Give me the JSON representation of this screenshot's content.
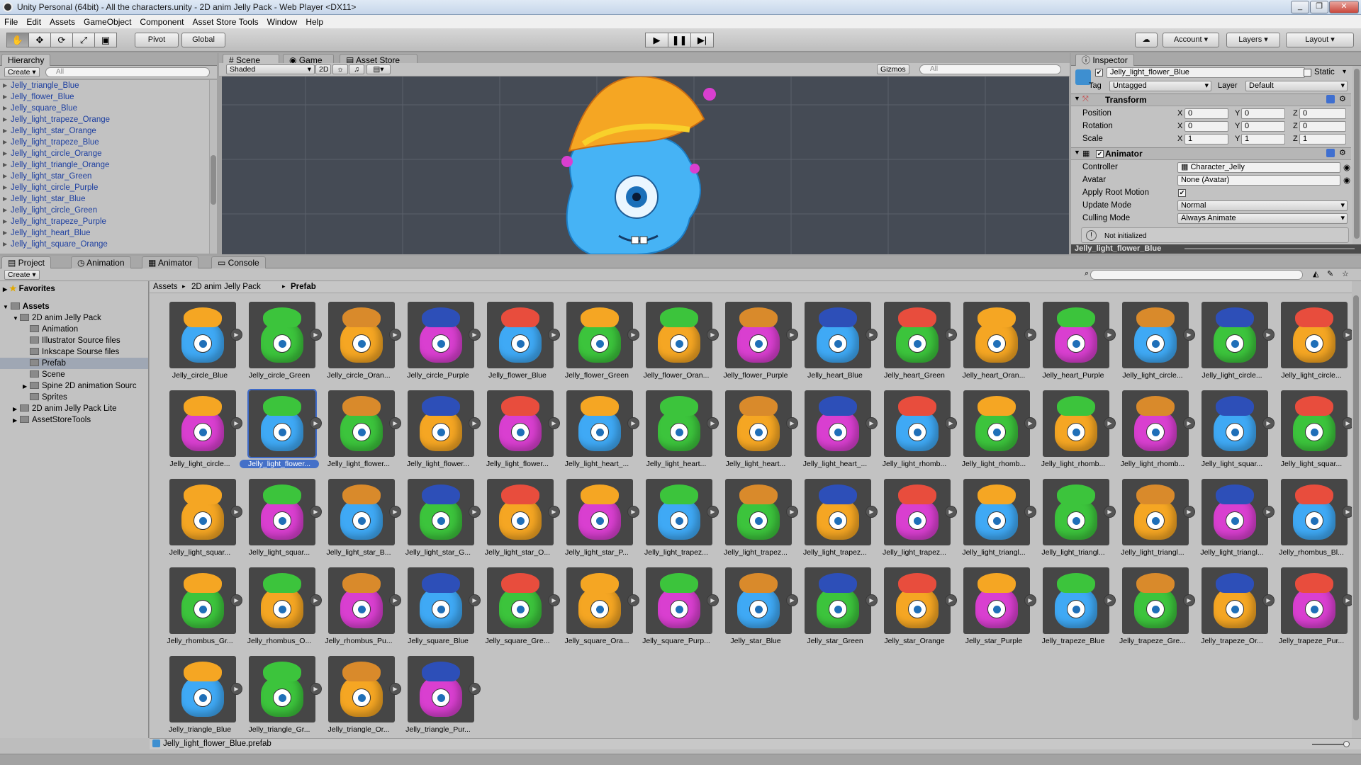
{
  "window": {
    "title": "Unity Personal (64bit) - All the characters.unity - 2D anim Jelly Pack - Web Player <DX11>"
  },
  "menu": [
    "File",
    "Edit",
    "Assets",
    "GameObject",
    "Component",
    "Asset Store Tools",
    "Window",
    "Help"
  ],
  "toolbar": {
    "pivot": "Pivot",
    "global": "Global",
    "account": "Account",
    "layers": "Layers",
    "layout": "Layout"
  },
  "hierarchy": {
    "tab": "Hierarchy",
    "create": "Create",
    "search_placeholder": "All",
    "items": [
      "Jelly_triangle_Blue",
      "Jelly_flower_Blue",
      "Jelly_square_Blue",
      "Jelly_light_trapeze_Orange",
      "Jelly_light_star_Orange",
      "Jelly_light_trapeze_Blue",
      "Jelly_light_circle_Orange",
      "Jelly_light_triangle_Orange",
      "Jelly_light_star_Green",
      "Jelly_light_circle_Purple",
      "Jelly_light_star_Blue",
      "Jelly_light_circle_Green",
      "Jelly_light_trapeze_Purple",
      "Jelly_light_heart_Blue",
      "Jelly_light_square_Orange"
    ]
  },
  "scene": {
    "tabs": [
      "Scene",
      "Game",
      "Asset Store"
    ],
    "shading": "Shaded",
    "mode2d": "2D",
    "gizmos": "Gizmos",
    "search_placeholder": "All"
  },
  "inspector": {
    "tab": "Inspector",
    "object_name": "Jelly_light_flower_Blue",
    "static": "Static",
    "tag_label": "Tag",
    "tag": "Untagged",
    "layer_label": "Layer",
    "layer": "Default",
    "transform": {
      "title": "Transform",
      "position_label": "Position",
      "rotation_label": "Rotation",
      "scale_label": "Scale",
      "position": [
        "0",
        "0",
        "0"
      ],
      "rotation": [
        "0",
        "0",
        "0"
      ],
      "scale": [
        "1",
        "1",
        "1"
      ]
    },
    "animator": {
      "title": "Animator",
      "controller_label": "Controller",
      "controller": "Character_Jelly",
      "avatar_label": "Avatar",
      "avatar": "None (Avatar)",
      "root_motion_label": "Apply Root Motion",
      "update_label": "Update Mode",
      "update": "Normal",
      "culling_label": "Culling Mode",
      "culling": "Always Animate",
      "status": "Not initialized"
    },
    "preview_name": "Jelly_light_flower_Blue"
  },
  "bottom_tabs": [
    "Project",
    "Animation",
    "Animator",
    "Console"
  ],
  "project": {
    "create": "Create",
    "favorites": "Favorites",
    "assets": "Assets",
    "tree": [
      "2D anim Jelly Pack",
      "Animation",
      "Illustrator Source files",
      "Inkscape Sourse files",
      "Prefab",
      "Scene",
      "Spine 2D animation Sourc",
      "Sprites",
      "2D anim Jelly Pack Lite",
      "AssetStoreTools"
    ],
    "breadcrumb": [
      "Assets",
      "2D anim Jelly Pack",
      "Prefab"
    ],
    "items": [
      "Jelly_circle_Blue",
      "Jelly_circle_Green",
      "Jelly_circle_Oran...",
      "Jelly_circle_Purple",
      "Jelly_flower_Blue",
      "Jelly_flower_Green",
      "Jelly_flower_Oran...",
      "Jelly_flower_Purple",
      "Jelly_heart_Blue",
      "Jelly_heart_Green",
      "Jelly_heart_Oran...",
      "Jelly_heart_Purple",
      "Jelly_light_circle...",
      "Jelly_light_circle...",
      "Jelly_light_circle...",
      "Jelly_light_circle...",
      "Jelly_light_flower...",
      "Jelly_light_flower...",
      "Jelly_light_flower...",
      "Jelly_light_flower...",
      "Jelly_light_heart_...",
      "Jelly_light_heart...",
      "Jelly_light_heart...",
      "Jelly_light_heart_...",
      "Jelly_light_rhomb...",
      "Jelly_light_rhomb...",
      "Jelly_light_rhomb...",
      "Jelly_light_rhomb...",
      "Jelly_light_squar...",
      "Jelly_light_squar...",
      "Jelly_light_squar...",
      "Jelly_light_squar...",
      "Jelly_light_star_B...",
      "Jelly_light_star_G...",
      "Jelly_light_star_O...",
      "Jelly_light_star_P...",
      "Jelly_light_trapez...",
      "Jelly_light_trapez...",
      "Jelly_light_trapez...",
      "Jelly_light_trapez...",
      "Jelly_light_triangl...",
      "Jelly_light_triangl...",
      "Jelly_light_triangl...",
      "Jelly_light_triangl...",
      "Jelly_rhombus_Bl...",
      "Jelly_rhombus_Gr...",
      "Jelly_rhombus_O...",
      "Jelly_rhombus_Pu...",
      "Jelly_square_Blue",
      "Jelly_square_Gre...",
      "Jelly_square_Ora...",
      "Jelly_square_Purp...",
      "Jelly_star_Blue",
      "Jelly_star_Green",
      "Jelly_star_Orange",
      "Jelly_star_Purple",
      "Jelly_trapeze_Blue",
      "Jelly_trapeze_Gre...",
      "Jelly_trapeze_Or...",
      "Jelly_trapeze_Pur...",
      "Jelly_triangle_Blue",
      "Jelly_triangle_Gr...",
      "Jelly_triangle_Or...",
      "Jelly_triangle_Pur..."
    ],
    "selected_index": 16,
    "status_file": "Jelly_light_flower_Blue.prefab"
  },
  "colors": {
    "blue": "#3fa9f5",
    "green": "#3cc43c",
    "orange": "#f5a623",
    "purple": "#d93fd0",
    "selection": "#4470c8"
  }
}
